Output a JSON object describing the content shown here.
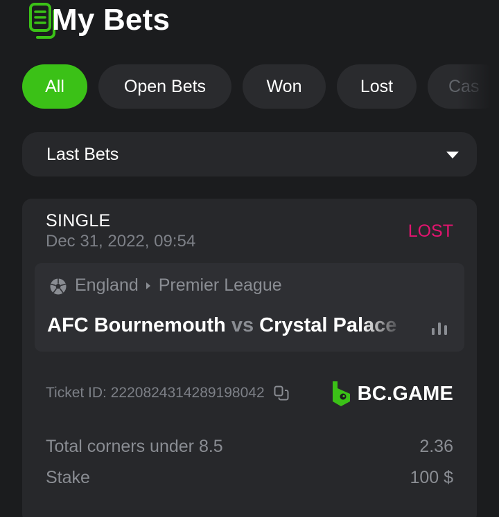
{
  "header": {
    "title": "My Bets",
    "icon": "bets-document-icon",
    "accent_color": "#3bc117"
  },
  "tabs": [
    {
      "label": "All",
      "active": true
    },
    {
      "label": "Open Bets",
      "active": false
    },
    {
      "label": "Won",
      "active": false
    },
    {
      "label": "Lost",
      "active": false
    },
    {
      "label": "Cas",
      "active": false
    }
  ],
  "filter": {
    "selected": "Last Bets"
  },
  "bet": {
    "type": "SINGLE",
    "date": "Dec 31, 2022, 09:54",
    "status": "LOST",
    "status_color": "#e3146f",
    "league": {
      "country": "England",
      "competition": "Premier League"
    },
    "match": {
      "home": "AFC Bournemouth",
      "vs": "vs",
      "away": "Crystal Palace"
    },
    "ticket_id": "Ticket ID: 2220824314289198042",
    "brand": "BC.GAME",
    "selection": {
      "label": "Total corners under 8.5",
      "odds": "2.36"
    },
    "stake": {
      "label": "Stake",
      "value": "100 $"
    }
  }
}
